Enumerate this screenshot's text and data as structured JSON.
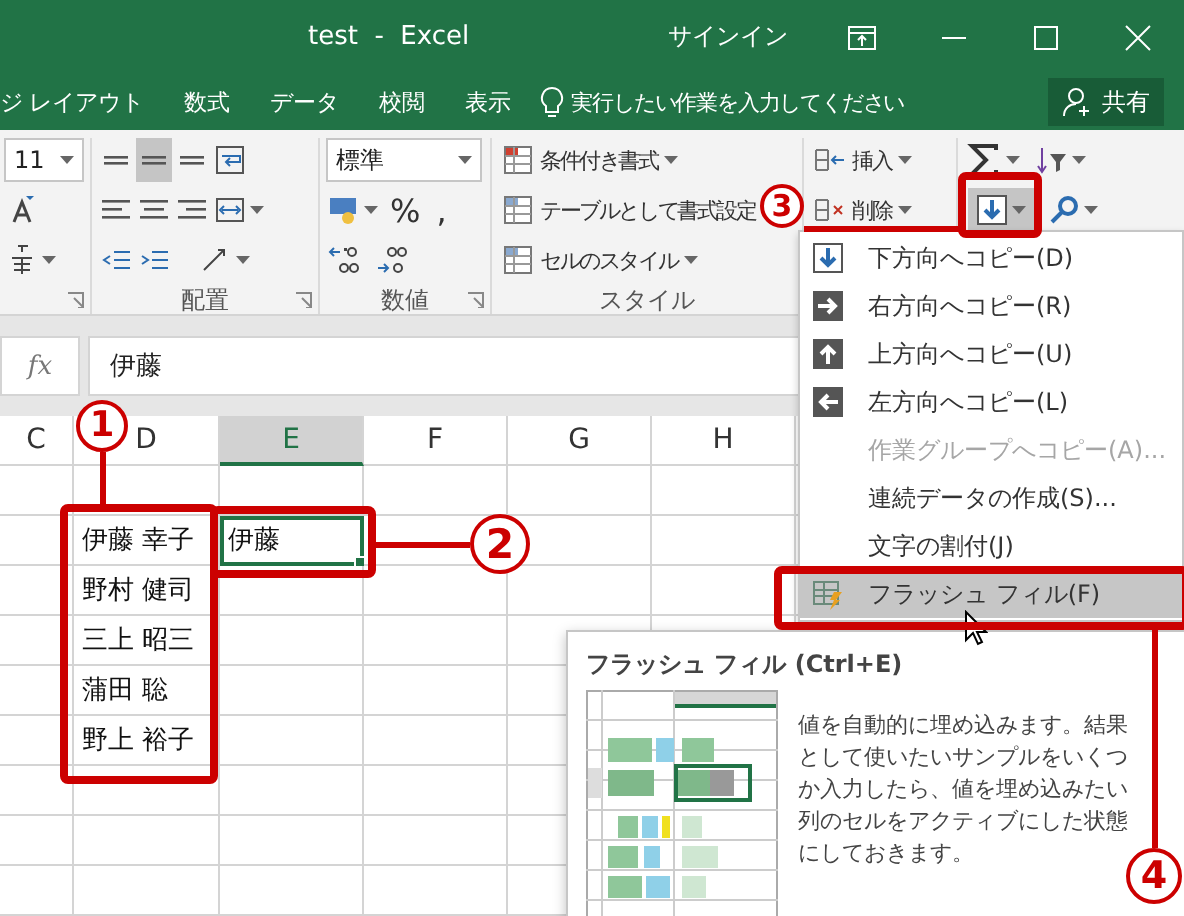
{
  "window": {
    "title": "test  -  Excel",
    "sign_in": "サインイン"
  },
  "ribbon_tabs": [
    "ジ レイアウト",
    "数式",
    "データ",
    "校閲",
    "表示"
  ],
  "tell_me": {
    "placeholder": "実行したい作業を入力してください"
  },
  "share_button": {
    "label": "共有"
  },
  "ribbon": {
    "font_size": "11",
    "vertical_alignment": [
      {
        "selected": false
      },
      {
        "selected": true
      },
      {
        "selected": false
      }
    ],
    "alignment_group": {
      "label": "配置"
    },
    "number_group": {
      "label": "数値",
      "format": "標準",
      "percent": "%",
      "comma": ","
    },
    "styles_group": {
      "label": "スタイル",
      "commands": [
        "条件付き書式",
        "テーブルとして書式設定",
        "セルのスタイル"
      ]
    },
    "cells_group": {
      "commands": [
        "挿入",
        "削除"
      ]
    },
    "editing_group": {
      "fill_button": {
        "selected": true
      }
    }
  },
  "formula_bar": {
    "fx": "fx",
    "value": "伊藤"
  },
  "sheet": {
    "columns": [
      {
        "label": "C",
        "selected": false
      },
      {
        "label": "D",
        "selected": false
      },
      {
        "label": "E",
        "selected": true
      },
      {
        "label": "F",
        "selected": false
      },
      {
        "label": "G",
        "selected": false
      },
      {
        "label": "H",
        "selected": false
      }
    ],
    "column_d": [
      "伊藤 幸子",
      "野村 健司",
      "三上 昭三",
      "蒲田 聡",
      "野上 裕子"
    ],
    "active_cell": {
      "value": "伊藤"
    }
  },
  "fill_menu": {
    "items": [
      {
        "label": "下方向へコピー(D)",
        "kind": "down",
        "disabled": false,
        "selected": false
      },
      {
        "label": "右方向へコピー(R)",
        "kind": "right",
        "disabled": false,
        "selected": false
      },
      {
        "label": "上方向へコピー(U)",
        "kind": "up",
        "disabled": false,
        "selected": false
      },
      {
        "label": "左方向へコピー(L)",
        "kind": "left",
        "disabled": false,
        "selected": false
      },
      {
        "label": "作業グループへコピー(A)...",
        "kind": "plain",
        "disabled": true,
        "selected": false
      },
      {
        "label": "連続データの作成(S)...",
        "kind": "plain",
        "disabled": false,
        "selected": false
      },
      {
        "label": "文字の割付(J)",
        "kind": "plain",
        "disabled": false,
        "selected": false
      },
      {
        "label": "フラッシュ フィル(F)",
        "kind": "flash",
        "disabled": false,
        "selected": true
      }
    ]
  },
  "tooltip": {
    "title": "フラッシュ フィル (Ctrl+E)",
    "text": "値を自動的に埋め込みます。結果として使いたいサンプルをいくつか入力したら、値を埋め込みたい列のセルをアクティブにした状態にしておきます。"
  },
  "annotations": [
    {
      "label": "1"
    },
    {
      "label": "2"
    },
    {
      "label": "3"
    },
    {
      "label": "4"
    }
  ]
}
